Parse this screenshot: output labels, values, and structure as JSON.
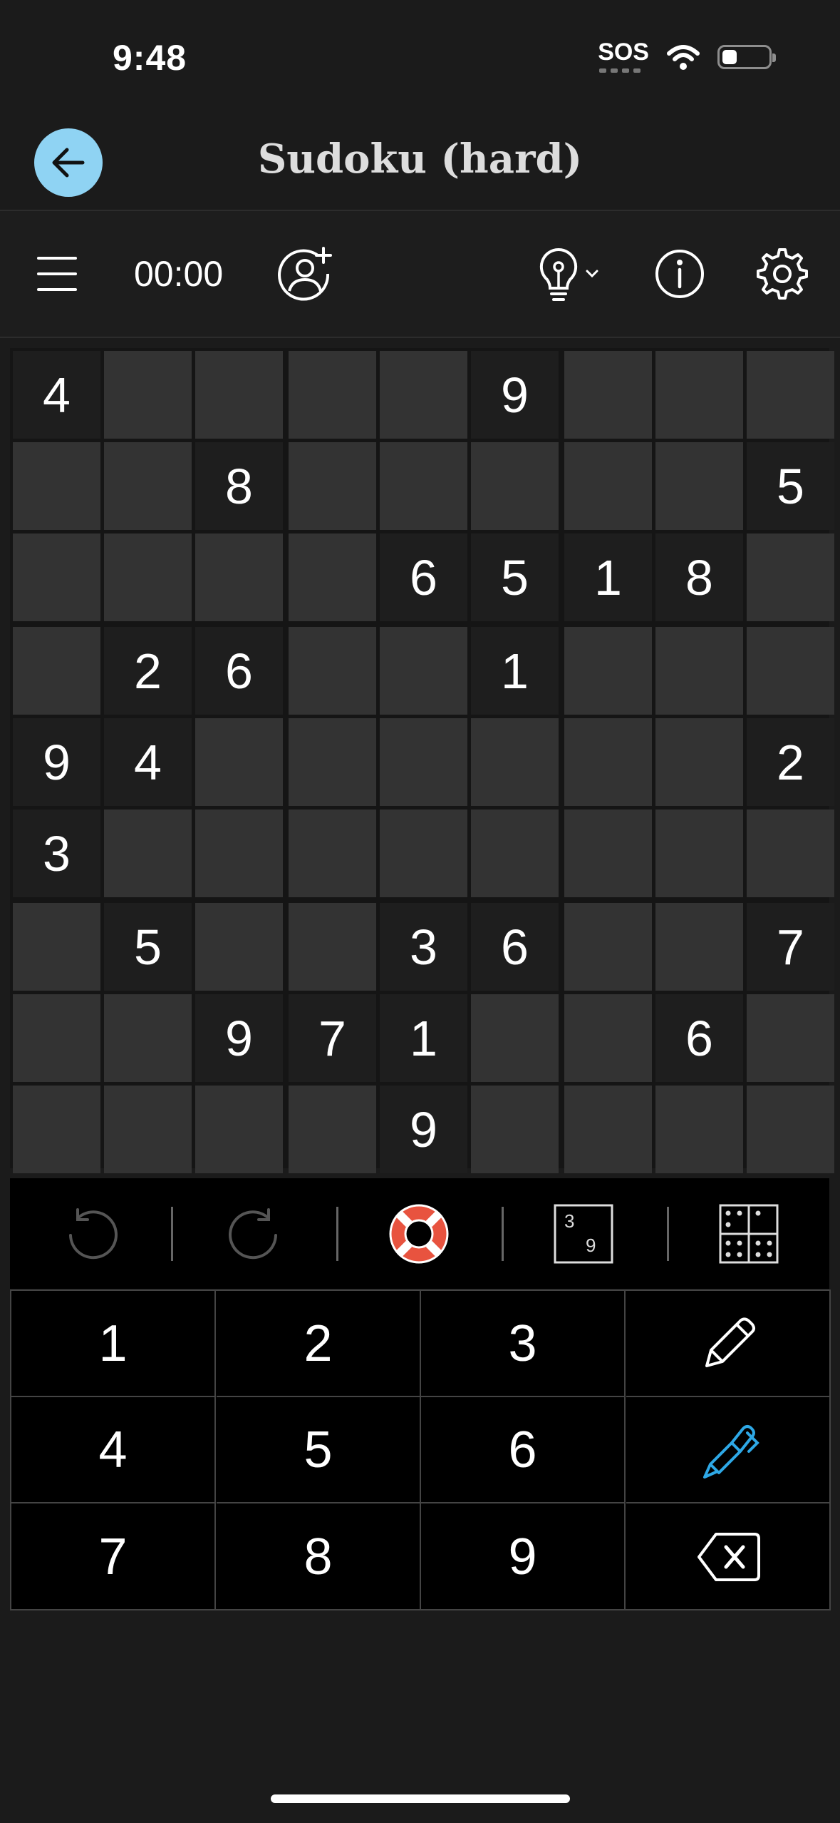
{
  "status": {
    "time": "9:48",
    "sos": "SOS"
  },
  "header": {
    "title": "Sudoku (hard)"
  },
  "toolbar": {
    "timer": "00:00"
  },
  "board": {
    "grid": [
      [
        "4",
        "",
        "",
        "",
        "",
        "9",
        "",
        "",
        ""
      ],
      [
        "",
        "",
        "8",
        "",
        "",
        "",
        "",
        "",
        "5"
      ],
      [
        "",
        "",
        "",
        "",
        "6",
        "5",
        "1",
        "8",
        ""
      ],
      [
        "",
        "2",
        "6",
        "",
        "",
        "1",
        "",
        "",
        ""
      ],
      [
        "9",
        "4",
        "",
        "",
        "",
        "",
        "",
        "",
        "2"
      ],
      [
        "3",
        "",
        "",
        "",
        "",
        "",
        "",
        "",
        ""
      ],
      [
        "",
        "5",
        "",
        "",
        "3",
        "6",
        "",
        "",
        "7"
      ],
      [
        "",
        "",
        "9",
        "7",
        "1",
        "",
        "",
        "6",
        ""
      ],
      [
        "",
        "",
        "",
        "",
        "9",
        "",
        "",
        "",
        ""
      ]
    ]
  },
  "actions": {
    "note_sample_top": "3",
    "note_sample_bottom": "9"
  },
  "keypad": {
    "keys": [
      "1",
      "2",
      "3",
      "4",
      "5",
      "6",
      "7",
      "8",
      "9"
    ]
  },
  "colors": {
    "accent_blue": "#8fd3f3",
    "pen_blue": "#2ea8e6",
    "lifebuoy_red": "#e8533f"
  },
  "icons": [
    "back-arrow-icon",
    "menu-icon",
    "add-user-icon",
    "lightbulb-icon",
    "chevron-down-icon",
    "info-icon",
    "gear-icon",
    "undo-icon",
    "redo-icon",
    "lifebuoy-icon",
    "notes-icon",
    "grid-icon",
    "pencil-icon",
    "pen-icon",
    "backspace-icon"
  ]
}
